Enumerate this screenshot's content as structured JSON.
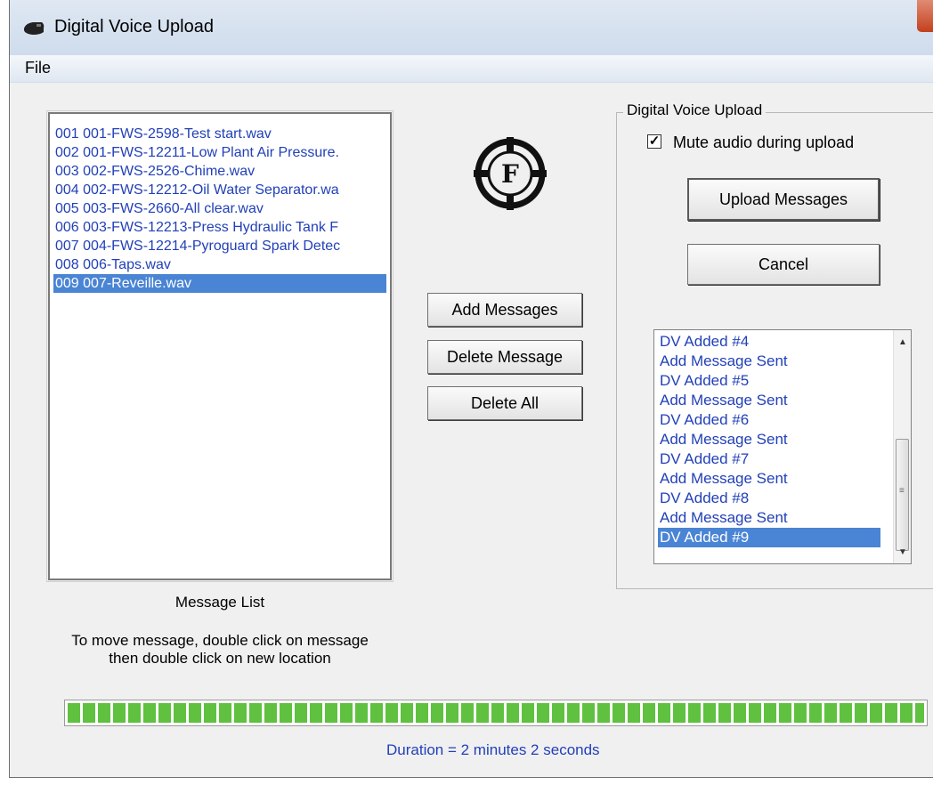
{
  "window": {
    "title": "Digital Voice Upload"
  },
  "menu": {
    "file": "File"
  },
  "message_list": {
    "items": [
      "001 001-FWS-2598-Test start.wav",
      "002 001-FWS-12211-Low Plant Air Pressure.",
      "003 002-FWS-2526-Chime.wav",
      "004 002-FWS-12212-Oil Water Separator.wa",
      "005 003-FWS-2660-All clear.wav",
      "006 003-FWS-12213-Press Hydraulic Tank F",
      "007 004-FWS-12214-Pyroguard Spark Detec",
      "008 006-Taps.wav",
      "009 007-Reveille.wav"
    ],
    "selected_index": 8,
    "caption": "Message List",
    "help_line1": "To move message, double click on message",
    "help_line2": "then double click on new location"
  },
  "buttons": {
    "add": "Add Messages",
    "delete": "Delete Message",
    "delete_all": "Delete All",
    "upload": "Upload Messages",
    "cancel": "Cancel"
  },
  "upload_group": {
    "title": "Digital Voice Upload",
    "mute_label": "Mute audio during upload",
    "mute_checked": true,
    "check_glyph": "✓"
  },
  "status_list": {
    "items": [
      "DV Added #4",
      "Add Message Sent",
      "DV Added #5",
      "Add Message Sent",
      "DV Added #6",
      "Add Message Sent",
      "DV Added #7",
      "Add Message Sent",
      "DV Added #8",
      "Add Message Sent",
      "DV Added #9"
    ],
    "selected_index": 10
  },
  "progress": {
    "percent": 100,
    "color": "#5fc13f"
  },
  "duration_text": "Duration = 2 minutes 2 seconds",
  "colors": {
    "list_text": "#2240b8",
    "selection": "#4a84d4"
  }
}
